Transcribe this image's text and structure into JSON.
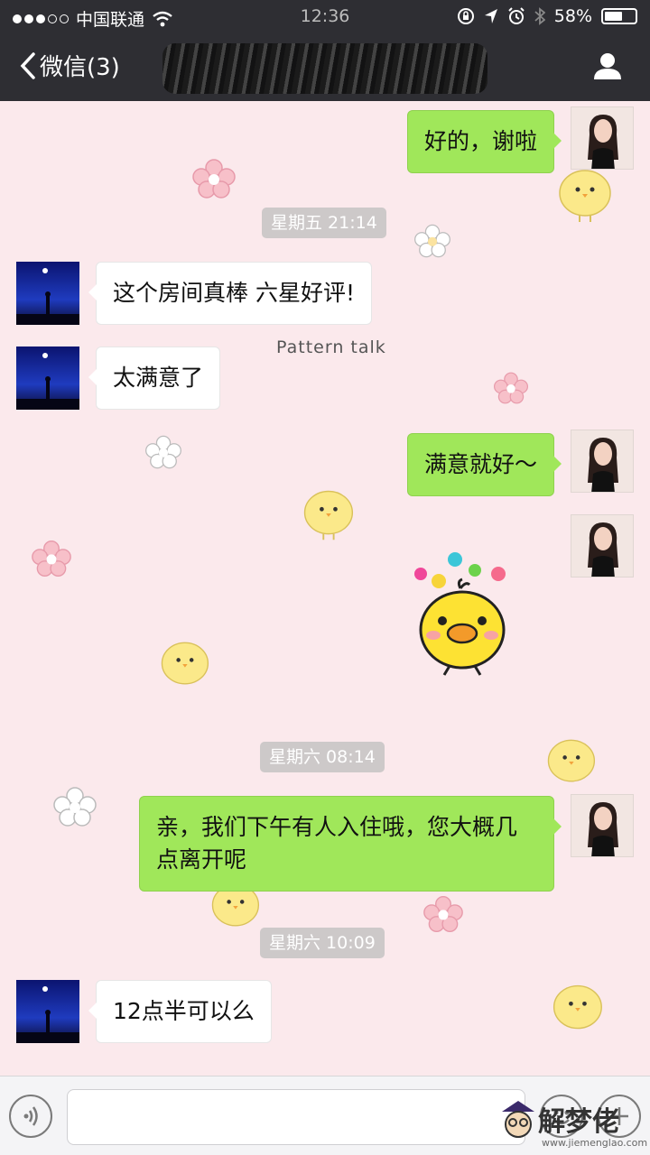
{
  "status_bar": {
    "carrier": "中国联通",
    "time": "12:36",
    "battery": "58%",
    "battery_level": 0.58
  },
  "nav": {
    "back_label": "微信(3)"
  },
  "messages": [
    {
      "side": "right",
      "text": "好的，谢啦"
    },
    {
      "type": "timestamp",
      "text": "星期五 21:14"
    },
    {
      "side": "left",
      "text": "这个房间真棒 六星好评!"
    },
    {
      "side": "left",
      "text": "太满意了"
    },
    {
      "side": "right",
      "text": "满意就好～"
    },
    {
      "side": "right",
      "type": "sticker",
      "sticker": "yellow-chick-flowers"
    },
    {
      "type": "timestamp",
      "text": "星期六 08:14"
    },
    {
      "side": "right",
      "text": "亲，我们下午有人入住哦，您大概几点离开呢"
    },
    {
      "type": "timestamp",
      "text": "星期六 10:09"
    },
    {
      "side": "left",
      "text": "12点半可以么"
    }
  ],
  "wallpaper": {
    "text": "Pattern talk"
  },
  "input": {
    "placeholder": ""
  },
  "watermark": {
    "text": "解梦佬",
    "url": "www.jiemenglao.com"
  },
  "colors": {
    "nav_bg": "#2e2e33",
    "chat_bg": "#fbe9ec",
    "bubble_right": "#a0e75a",
    "bubble_left": "#ffffff"
  },
  "icons": [
    "wifi-icon",
    "lock-rotation-icon",
    "location-icon",
    "alarm-icon",
    "bluetooth-icon",
    "battery-icon",
    "back-chevron-icon",
    "person-icon",
    "voice-icon",
    "emoji-icon",
    "plus-icon"
  ]
}
